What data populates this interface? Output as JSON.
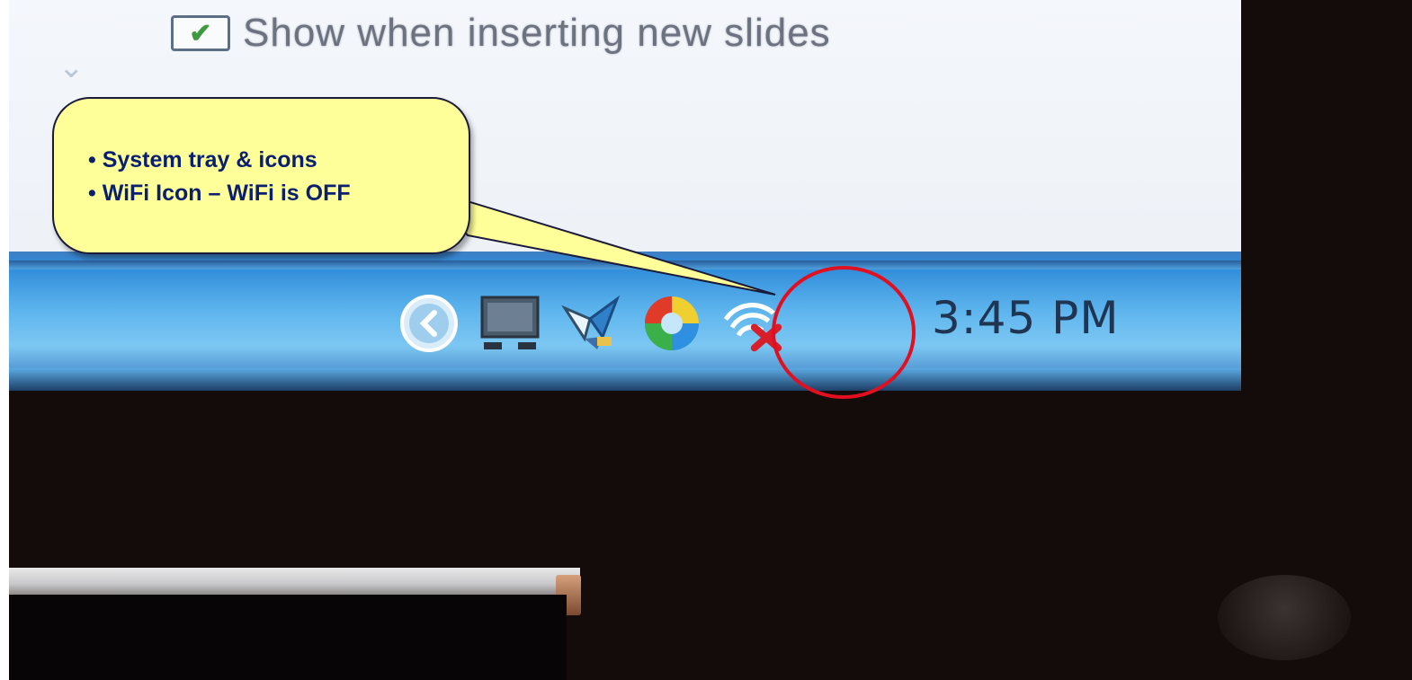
{
  "dialog": {
    "checkbox_checked": true,
    "checkbox_label": "Show when inserting new slides"
  },
  "taskbar": {
    "clock": "3:45 PM",
    "tray_icons": [
      "show-hidden-icons-icon",
      "network-monitor-icon",
      "butterfly-app-icon",
      "colorful-app-icon",
      "wifi-off-icon"
    ]
  },
  "callout": {
    "line1": "• System tray & icons",
    "line2": "• WiFi Icon – WiFi is OFF"
  },
  "colors": {
    "callout_fill": "#ffff99",
    "callout_text": "#0a1f6e",
    "highlight_ring": "#e01020",
    "taskbar": "#5fb6ee"
  }
}
